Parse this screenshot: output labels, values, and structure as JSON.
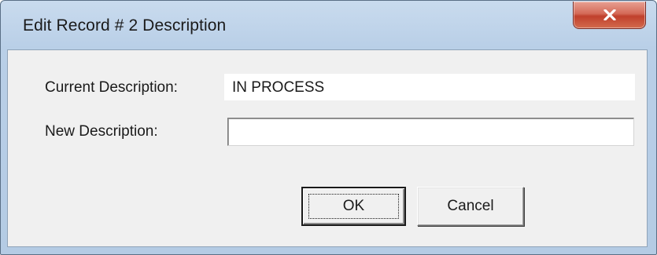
{
  "window": {
    "title": "Edit Record # 2 Description",
    "close_icon": "close-x-icon"
  },
  "form": {
    "current_label": "Current Description:",
    "current_value": "IN PROCESS",
    "new_label": "New Description:",
    "new_value": "",
    "new_placeholder": ""
  },
  "buttons": {
    "ok_label": "OK",
    "cancel_label": "Cancel"
  },
  "colors": {
    "titlebar": "#b9cfe7",
    "close_button": "#c74a36",
    "client_background": "#f0f0f0"
  }
}
